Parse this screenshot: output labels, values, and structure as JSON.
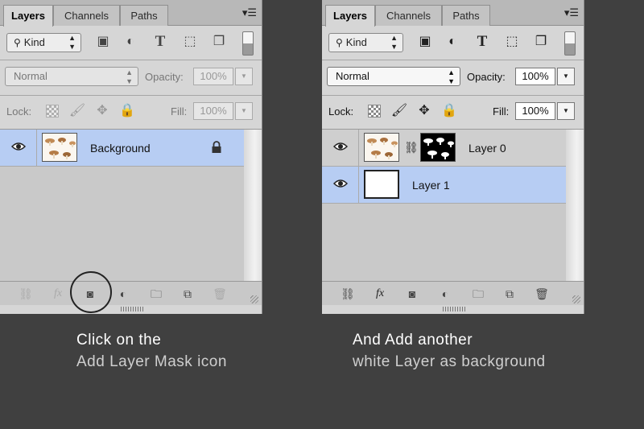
{
  "panels": [
    {
      "tabs": [
        "Layers",
        "Channels",
        "Paths"
      ],
      "filter_kind": "Kind",
      "blend_mode": "Normal",
      "opacity_label": "Opacity:",
      "opacity_value": "100%",
      "lock_label": "Lock:",
      "fill_label": "Fill:",
      "fill_value": "100%",
      "layers": [
        {
          "name": "Background",
          "selected": true,
          "locked": true
        }
      ]
    },
    {
      "tabs": [
        "Layers",
        "Channels",
        "Paths"
      ],
      "filter_kind": "Kind",
      "blend_mode": "Normal",
      "opacity_label": "Opacity:",
      "opacity_value": "100%",
      "lock_label": "Lock:",
      "fill_label": "Fill:",
      "fill_value": "100%",
      "layers": [
        {
          "name": "Layer 0",
          "selected": false,
          "has_mask": true
        },
        {
          "name": "Layer 1",
          "selected": true
        }
      ]
    }
  ],
  "captions": {
    "left_title": "Click on the",
    "left_sub": "Add Layer Mask icon",
    "right_title": "And Add another",
    "right_sub": "white Layer as background"
  },
  "colors": {
    "page_background": "#404040",
    "panel_background": "#d6d6d6",
    "selected_layer": "#b7cdf3"
  },
  "icons": {
    "bottom_bar": [
      "link-layers-icon",
      "fx-icon",
      "add-layer-mask-icon",
      "adjustment-layer-icon",
      "new-group-icon",
      "new-layer-icon",
      "trash-icon"
    ]
  }
}
